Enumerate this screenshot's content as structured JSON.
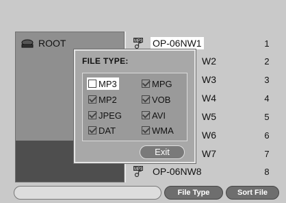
{
  "left_panel": {
    "root_label": "ROOT",
    "root_icon": "drive-icon"
  },
  "file_list": {
    "items": [
      {
        "name": "OP-06NW1",
        "number": "1",
        "icon": "mp3-file-icon",
        "selected": true
      },
      {
        "name": "W2",
        "number": "2"
      },
      {
        "name": "W3",
        "number": "3"
      },
      {
        "name": "W4",
        "number": "4"
      },
      {
        "name": "W5",
        "number": "5"
      },
      {
        "name": "W6",
        "number": "6"
      },
      {
        "name": "W7",
        "number": "7"
      },
      {
        "name": "OP-06NW8",
        "number": "8",
        "icon": "mp3-file-icon"
      }
    ],
    "icon_badge": "MP3"
  },
  "dialog": {
    "title": "FILE TYPE:",
    "options": [
      {
        "label": "MP3",
        "checked": false,
        "selected": true
      },
      {
        "label": "MPG",
        "checked": true
      },
      {
        "label": "MP2",
        "checked": true
      },
      {
        "label": "VOB",
        "checked": true
      },
      {
        "label": "JPEG",
        "checked": true
      },
      {
        "label": "AVI",
        "checked": true
      },
      {
        "label": "DAT",
        "checked": true
      },
      {
        "label": "WMA",
        "checked": true
      }
    ],
    "exit_label": "Exit"
  },
  "bottom_bar": {
    "file_type_label": "File Type",
    "sort_file_label": "Sort File"
  },
  "colors": {
    "background": "#c9c9c9",
    "dialog": "#a8a8a8",
    "button": "#6e6e6e",
    "selected": "#ffffff"
  }
}
